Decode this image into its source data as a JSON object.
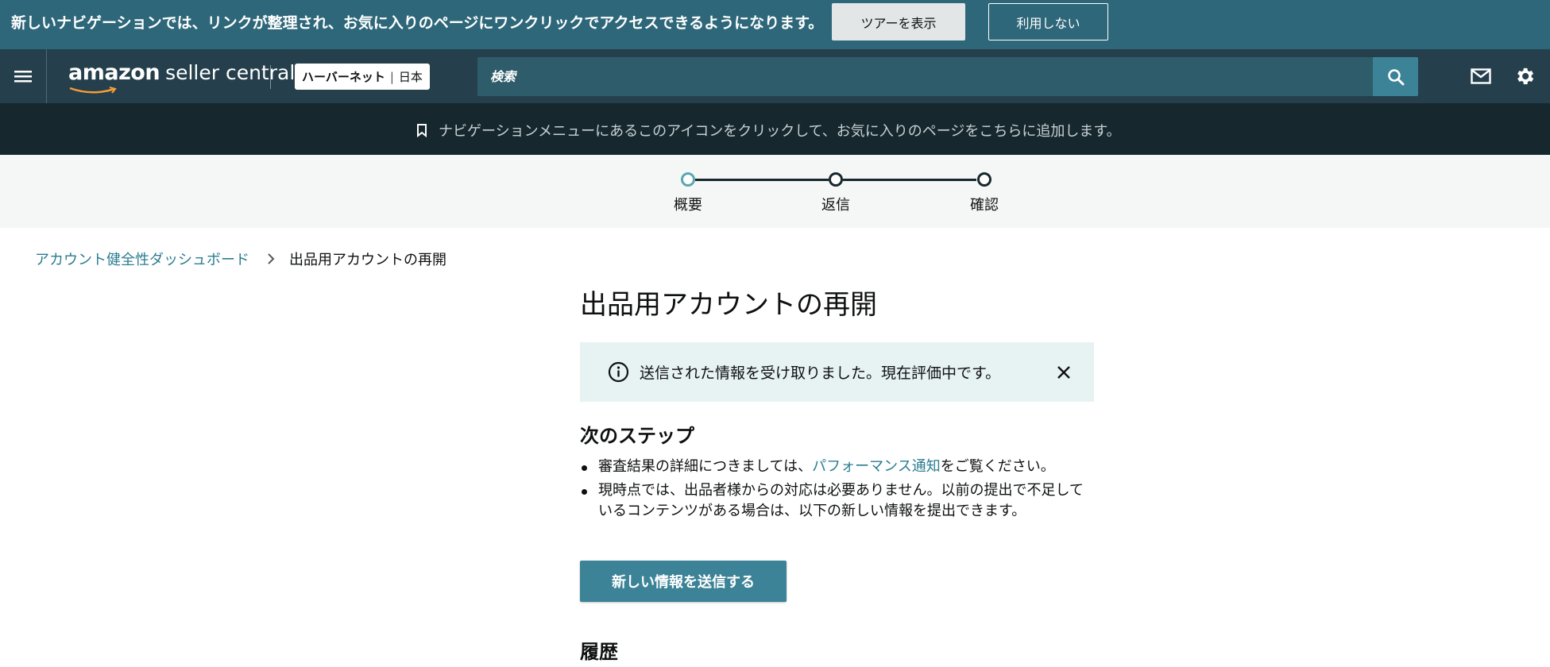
{
  "announcement": {
    "text": "新しいナビゲーションでは、リンクが整理され、お気に入りのページにワンクリックでアクセスできるようになります。",
    "tour_label": "ツアーを表示",
    "optout_label": "利用しない"
  },
  "header": {
    "logo_amazon": "amazon",
    "logo_suffix": "seller central",
    "account_name": "ハーバーネット",
    "account_region": "日本",
    "search_placeholder": "検索",
    "icons": [
      "menu-icon",
      "search-icon",
      "mail-icon",
      "gear-icon"
    ]
  },
  "favorites_bar": {
    "text": "ナビゲーションメニューにあるこのアイコンをクリックして、お気に入りのページをこちらに追加します。",
    "icon": "bookmark-icon"
  },
  "stepper": {
    "steps": [
      {
        "label": "概要",
        "state": "current"
      },
      {
        "label": "返信",
        "state": "pending"
      },
      {
        "label": "確認",
        "state": "pending"
      }
    ]
  },
  "breadcrumb": {
    "parent": "アカウント健全性ダッシュボード",
    "current": "出品用アカウントの再開"
  },
  "main": {
    "title": "出品用アカウントの再開",
    "alert_text": "送信された情報を受け取りました。現在評価中です。",
    "next_steps_heading": "次のステップ",
    "item1_before": "審査結果の詳細につきましては、",
    "item1_link": "パフォーマンス通知",
    "item1_after": "をご覧ください。",
    "item2": "現時点では、出品者様からの対応は必要ありません。以前の提出で不足しているコンテンツがある場合は、以下の新しい情報を提出できます。",
    "submit_label": "新しい情報を送信する",
    "history_heading": "履歴"
  },
  "colors": {
    "announcement_bg": "#2e6779",
    "header_bg": "#25404c",
    "favorites_bg": "#16282e",
    "accent": "#3c8397",
    "link": "#2b7d91",
    "alert_bg": "#e7f2f3",
    "stepper_active": "#5aa7ad"
  }
}
